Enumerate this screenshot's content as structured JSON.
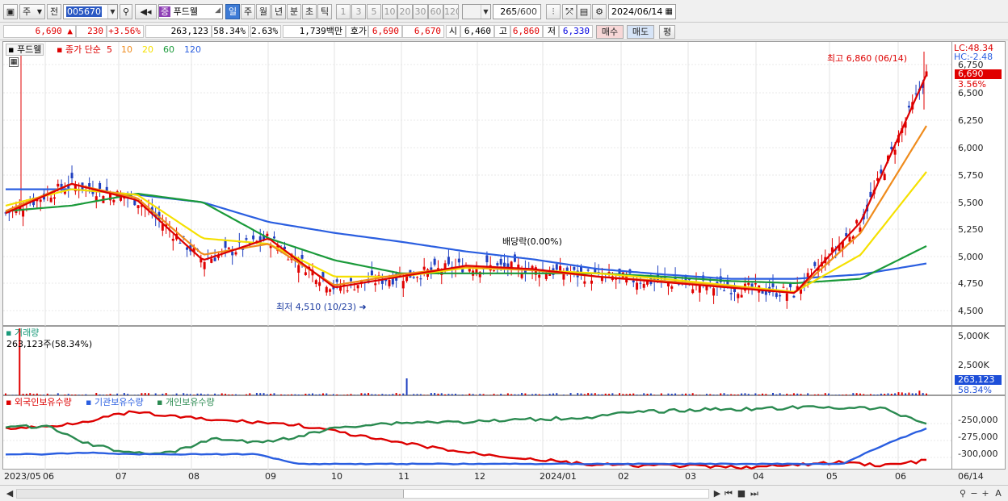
{
  "toolbar": {
    "market": "주",
    "market2": "전",
    "code": "005670",
    "stock_name": "푸드웰",
    "periods": [
      "일",
      "주",
      "월",
      "년",
      "분",
      "초",
      "틱"
    ],
    "selected_period": "일",
    "intervals": [
      "1",
      "3",
      "5",
      "10",
      "20",
      "30",
      "60",
      "120"
    ],
    "count": "265",
    "count_total": "/600",
    "date": "2024/06/14"
  },
  "quote": {
    "price": "6,690",
    "arrow": "▲",
    "change": "230",
    "change_pct": "+3.56%",
    "volume": "263,123",
    "vol_pct": "58.34%",
    "turnover_rate": "2.63%",
    "amount": "1,739백만",
    "hoga_label": "호가",
    "hoga_ask": "6,690",
    "hoga_bid": "6,670",
    "open_label": "시",
    "open": "6,460",
    "high_label": "고",
    "high": "6,860",
    "low_label": "저",
    "low": "6,330",
    "buy_label": "매수",
    "sell_label": "매도",
    "pyeong_label": "평"
  },
  "price_pane": {
    "legend_name": "푸드웰",
    "legend_ma": "종가 단순",
    "ma_periods": [
      "5",
      "10",
      "20",
      "60",
      "120"
    ],
    "ma_colors": [
      "#dd0000",
      "#ef8b1c",
      "#f5e000",
      "#1a9a3a",
      "#2a5ee0"
    ],
    "high_note": "최고 6,860 (06/14)",
    "low_note": "최저 4,510 (10/23)",
    "dividend_note": "배당락(0.00%)",
    "lc": "LC:48.34",
    "hc": "HC:-2.48",
    "price_tag": "6,690",
    "pct_tag": "3.56%",
    "y_ticks": [
      "6,750",
      "6,500",
      "6,250",
      "6,000",
      "5,750",
      "5,500",
      "5,250",
      "5,000",
      "4,750",
      "4,500"
    ]
  },
  "volume_pane": {
    "title": "거래량",
    "value_text": "263,123주(58.34%)",
    "y_ticks": [
      "5,000K",
      "2,500K"
    ],
    "vol_tag": "263,123",
    "pct_tag": "58.34%"
  },
  "holding_pane": {
    "series": [
      "외국인보유수량",
      "기관보유수량",
      "개인보유수량"
    ],
    "colors": [
      "#dd0000",
      "#2a5ee0",
      "#2a8a50"
    ],
    "y_ticks": [
      "-250,000",
      "-275,000",
      "-300,000"
    ]
  },
  "x_axis": [
    "2023/05",
    "06",
    "07",
    "08",
    "09",
    "10",
    "11",
    "12",
    "2024/01",
    "02",
    "03",
    "04",
    "05",
    "06"
  ],
  "x_axis_right": "06/14",
  "chart_data": {
    "type": "line",
    "title": "",
    "x": [
      "2023/05",
      "06",
      "07",
      "08",
      "09",
      "10",
      "11",
      "12",
      "2024/01",
      "02",
      "03",
      "04",
      "05",
      "06",
      "06/14"
    ],
    "series": [
      {
        "name": "5",
        "values": [
          5380,
          5650,
          5500,
          4950,
          5150,
          4700,
          4800,
          4900,
          4870,
          4800,
          4750,
          4700,
          4650,
          5300,
          6650
        ]
      },
      {
        "name": "10",
        "values": [
          5400,
          5650,
          5520,
          5000,
          5100,
          4720,
          4820,
          4890,
          4860,
          4800,
          4760,
          4710,
          4650,
          5200,
          6180
        ]
      },
      {
        "name": "20",
        "values": [
          5450,
          5600,
          5550,
          5150,
          5100,
          4800,
          4800,
          4880,
          4860,
          4830,
          4780,
          4720,
          4660,
          5000,
          5760
        ]
      },
      {
        "name": "60",
        "values": [
          5400,
          5450,
          5560,
          5480,
          5150,
          4950,
          4830,
          4830,
          4830,
          4830,
          4800,
          4760,
          4740,
          4780,
          5080
        ]
      },
      {
        "name": "120",
        "values": [
          5600,
          5600,
          5550,
          5480,
          5300,
          5200,
          5120,
          5030,
          4960,
          4870,
          4820,
          4780,
          4780,
          4820,
          4920
        ]
      }
    ],
    "ylim": [
      4400,
      6860
    ]
  }
}
